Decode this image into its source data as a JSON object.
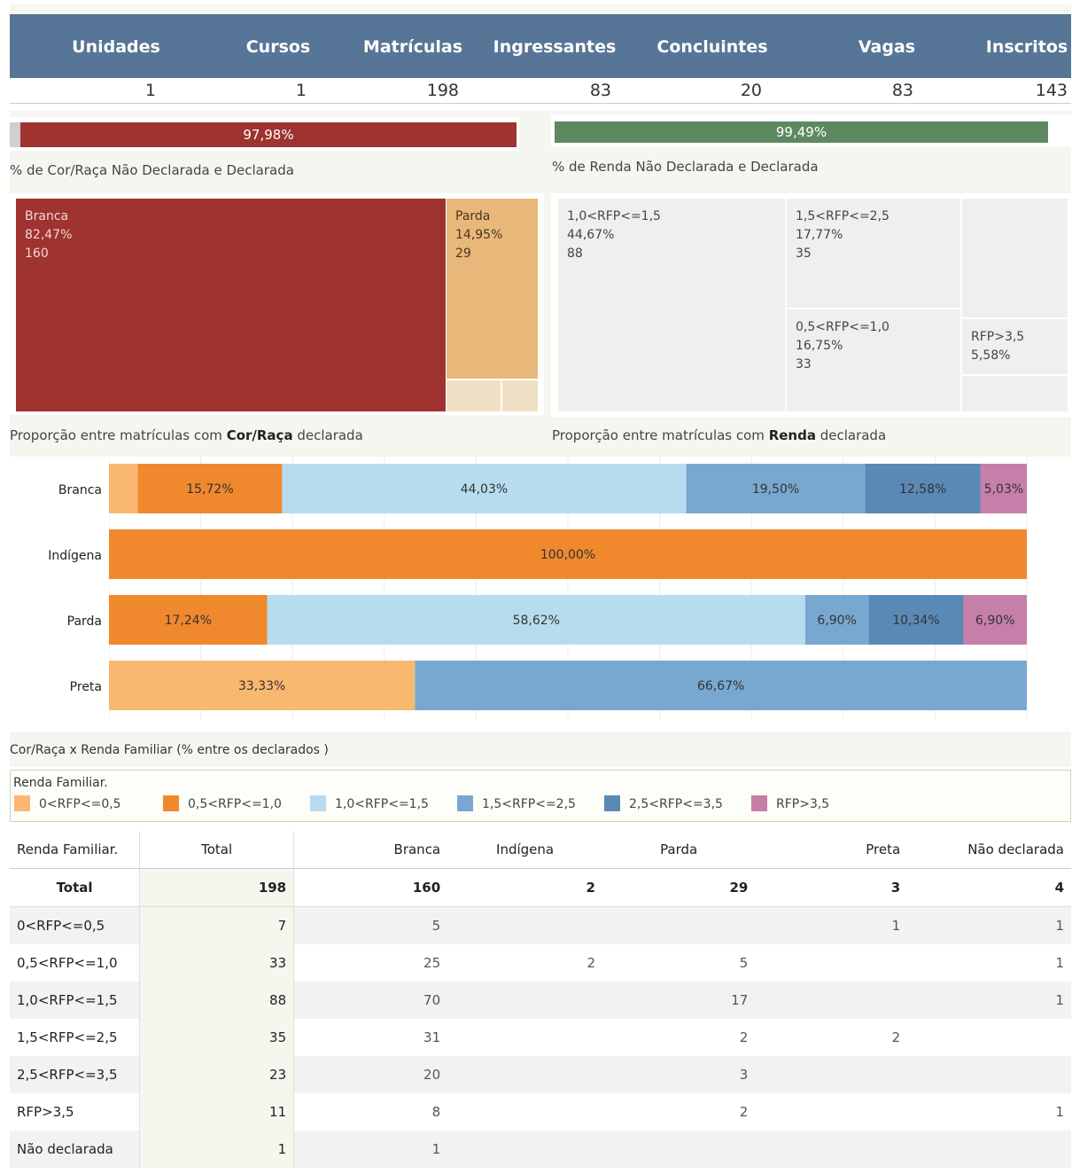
{
  "kpi": {
    "headers": [
      "Unidades",
      "Cursos",
      "Matrículas",
      "Ingressantes",
      "Concluintes",
      "Vagas",
      "Inscritos"
    ],
    "values": [
      "1",
      "1",
      "198",
      "83",
      "20",
      "83",
      "143"
    ],
    "header_color": "#577596"
  },
  "declared_bars": {
    "race": {
      "value_pct": 97.98,
      "label": "97,98%",
      "color": "#9e3330",
      "undeclared_color": "#cfcfcf",
      "caption": "% de Cor/Raça Não Declarada e Declarada"
    },
    "income": {
      "value_pct": 99.49,
      "label": "99,49%",
      "color": "#5e8860",
      "caption": "% de Renda Não Declarada e Declarada"
    }
  },
  "treemaps": {
    "race": {
      "caption_pre": "Proporção entre matrículas com ",
      "caption_bold": "Cor/Raça",
      "caption_post": " declarada",
      "cells": [
        {
          "name": "Branca",
          "pct": "82,47%",
          "count": "160",
          "value": 160,
          "color": "#9e3330",
          "text_color": "#f3d6d2"
        },
        {
          "name": "Parda",
          "pct": "14,95%",
          "count": "29",
          "value": 29,
          "color": "#e8b87a",
          "text_color": "#4a3520"
        },
        {
          "name": "",
          "pct": "",
          "count": "",
          "value": 3,
          "color": "#efdfc4",
          "text_color": "#4a3520"
        },
        {
          "name": "",
          "pct": "",
          "count": "",
          "value": 2,
          "color": "#efdfc4",
          "text_color": "#4a3520"
        }
      ]
    },
    "income": {
      "caption_pre": "Proporção entre matrículas com ",
      "caption_bold": "Renda",
      "caption_post": " declarada",
      "cells": [
        {
          "name": "1,0<RFP<=1,5",
          "pct": "44,67%",
          "count": "88",
          "value": 88
        },
        {
          "name": "1,5<RFP<=2,5",
          "pct": "17,77%",
          "count": "35",
          "value": 35
        },
        {
          "name": "0,5<RFP<=1,0",
          "pct": "16,75%",
          "count": "33",
          "value": 33
        },
        {
          "name": "",
          "pct": "",
          "count": "",
          "value": 23
        },
        {
          "name": "RFP>3,5",
          "pct": "5,58%",
          "count": "",
          "value": 11
        },
        {
          "name": "",
          "pct": "",
          "count": "",
          "value": 7
        }
      ]
    }
  },
  "chart_data": {
    "type": "bar",
    "orientation": "horizontal",
    "stacked": "100%",
    "title": "Cor/Raça x Renda Familiar (% entre os declarados )",
    "categories": [
      "Branca",
      "Indígena",
      "Parda",
      "Preta"
    ],
    "series": [
      {
        "name": "0<RFP<=0,5",
        "color": "#f9b870",
        "values": [
          3.14,
          0,
          0,
          33.33
        ],
        "labels": [
          "",
          "",
          "",
          "33,33%"
        ]
      },
      {
        "name": "0,5<RFP<=1,0",
        "color": "#f0882e",
        "values": [
          15.72,
          100,
          17.24,
          0
        ],
        "labels": [
          "15,72%",
          "100,00%",
          "17,24%",
          ""
        ]
      },
      {
        "name": "1,0<RFP<=1,5",
        "color": "#b7dcef",
        "values": [
          44.03,
          0,
          58.62,
          0
        ],
        "labels": [
          "44,03%",
          "",
          "58,62%",
          ""
        ]
      },
      {
        "name": "1,5<RFP<=2,5",
        "color": "#78a8d0",
        "values": [
          19.5,
          0,
          6.9,
          66.67
        ],
        "labels": [
          "19,50%",
          "",
          "6,90%",
          "66,67%"
        ]
      },
      {
        "name": "2,5<RFP<=3,5",
        "color": "#5b89b5",
        "values": [
          12.58,
          0,
          10.34,
          0
        ],
        "labels": [
          "12,58%",
          "",
          "10,34%",
          ""
        ]
      },
      {
        "name": "RFP>3,5",
        "color": "#c67fa8",
        "values": [
          5.03,
          0,
          6.9,
          0
        ],
        "labels": [
          "5,03%",
          "",
          "6,90%",
          ""
        ]
      }
    ],
    "xlim": [
      0,
      100
    ],
    "legend_title": "Renda Familiar.",
    "legend_position": "bottom",
    "grid": true
  },
  "table": {
    "headers": [
      "Renda Familiar.",
      "Total",
      "Branca",
      "Indígena",
      "Parda",
      "Preta",
      "Não declarada"
    ],
    "total_row": [
      "Total",
      "198",
      "160",
      "2",
      "29",
      "3",
      "4"
    ],
    "rows": [
      [
        "0<RFP<=0,5",
        "7",
        "5",
        "",
        "",
        "1",
        "1"
      ],
      [
        "0,5<RFP<=1,0",
        "33",
        "25",
        "2",
        "5",
        "",
        "1"
      ],
      [
        "1,0<RFP<=1,5",
        "88",
        "70",
        "",
        "17",
        "",
        "1"
      ],
      [
        "1,5<RFP<=2,5",
        "35",
        "31",
        "",
        "2",
        "2",
        ""
      ],
      [
        "2,5<RFP<=3,5",
        "23",
        "20",
        "",
        "3",
        "",
        ""
      ],
      [
        "RFP>3,5",
        "11",
        "8",
        "",
        "2",
        "",
        "1"
      ],
      [
        "Não declarada",
        "1",
        "1",
        "",
        "",
        "",
        ""
      ]
    ]
  }
}
